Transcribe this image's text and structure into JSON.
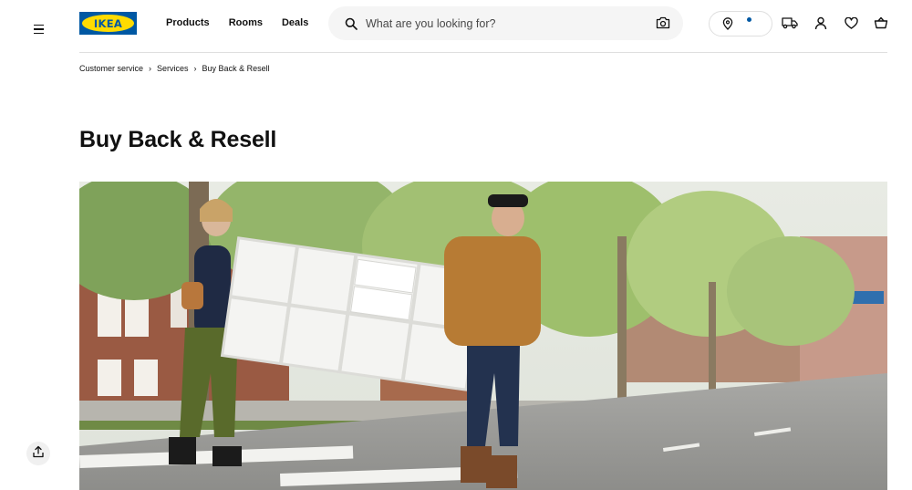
{
  "header": {
    "logo_text": "IKEA",
    "nav": [
      {
        "label": "Products"
      },
      {
        "label": "Rooms"
      },
      {
        "label": "Deals"
      }
    ],
    "search": {
      "placeholder": "What are you looking for?",
      "value": ""
    },
    "icons": [
      "hamburger-menu-icon",
      "search-icon",
      "camera-icon",
      "location-pin-icon",
      "delivery-truck-icon",
      "user-icon",
      "heart-icon",
      "shopping-bag-icon"
    ]
  },
  "breadcrumb": [
    {
      "label": "Customer service"
    },
    {
      "label": "Services"
    },
    {
      "label": "Buy Back & Resell"
    }
  ],
  "page": {
    "title": "Buy Back & Resell"
  },
  "hero_image": {
    "description_icon": "photo"
  },
  "floating": {
    "share_icon": "share-icon"
  },
  "colors": {
    "brand_blue": "#0058a3",
    "brand_yellow": "#ffdb00",
    "search_bg": "#f5f5f5",
    "divider": "#dfdfdf"
  }
}
